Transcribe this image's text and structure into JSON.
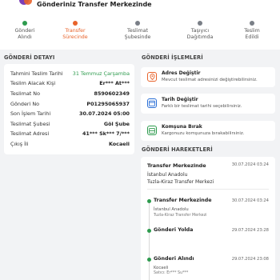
{
  "header": {
    "title": "Gönderiniz Transfer Merkezinde",
    "brand_color": "#7b3fb8",
    "accent_color": "#e8632b"
  },
  "stepper": {
    "steps": [
      {
        "label_line1": "Gönderi",
        "label_line2": "Alındı",
        "state": "done"
      },
      {
        "label_line1": "Transfer",
        "label_line2": "Sürecinde",
        "state": "active"
      },
      {
        "label_line1": "Teslimat",
        "label_line2": "Şubesinde",
        "state": "todo"
      },
      {
        "label_line1": "Taşıyıcı",
        "label_line2": "Dağıtımda",
        "state": "todo"
      },
      {
        "label_line1": "Teslim",
        "label_line2": "Edildi",
        "state": "todo"
      }
    ]
  },
  "detail": {
    "heading": "GÖNDERİ DETAYI",
    "rows": [
      {
        "key": "Tahmini Teslim Tarihi",
        "value": "31 Temmuz Çarşamba"
      },
      {
        "key": "Teslim Alacak Kişi",
        "value": "Er*** At***"
      },
      {
        "key": "Teslimat No",
        "value": "8590602349"
      },
      {
        "key": "Gönderi No",
        "value": "P01295065937"
      },
      {
        "key": "Son İşlem Tarihi",
        "value": "30.07.2024 05:00"
      },
      {
        "key": "Teslimat Şubesi",
        "value": "Göl Şube"
      },
      {
        "key": "Teslimat Adresi",
        "value": "41*** Sk*** 7/***"
      },
      {
        "key": "Çıkış İli",
        "value": "Kocaeli"
      }
    ]
  },
  "operations": {
    "heading": "GÖNDERİ İŞLEMLERİ",
    "items": [
      {
        "title": "Adres Değiştir",
        "desc": "Mevcut teslimat adresinizi değiştirebilirsiniz.",
        "icon": "location-pin-icon",
        "color": "#e8632b"
      },
      {
        "title": "Tarih Değiştir",
        "desc": "Farklı bir teslimat tarihi seçebilirsiniz.",
        "icon": "calendar-icon",
        "color": "#2a6fd6"
      },
      {
        "title": "Komşuna Bırak",
        "desc": "Kargonuzu komşunuza bırakabilirsiniz.",
        "icon": "neighbor-icon",
        "color": "#2e9b4e"
      }
    ]
  },
  "movements": {
    "heading": "GÖNDERİ HAREKETLERİ",
    "current": {
      "title": "Transfer Merkezinde",
      "date": "30.07.2024 03:24",
      "line1": "İstanbul Anadolu",
      "line2": "Tuzla-Kiraz Transfer Merkezi"
    },
    "events": [
      {
        "title": "Transfer Merkezinde",
        "date": "30.07.2024 03:24",
        "sub1": "İstanbul Anadolu",
        "sub2": "Tuzla-Kiraz Transfer Merkezi"
      },
      {
        "title": "Gönderi Yolda",
        "date": "29.07.2024 23:28",
        "sub1": "",
        "sub2": ""
      },
      {
        "title": "Gönderi Alındı",
        "date": "29.07.2024 23:08",
        "sub1": "Kocaeli",
        "sub2": "Satıcı: Er*** Su***"
      }
    ]
  }
}
